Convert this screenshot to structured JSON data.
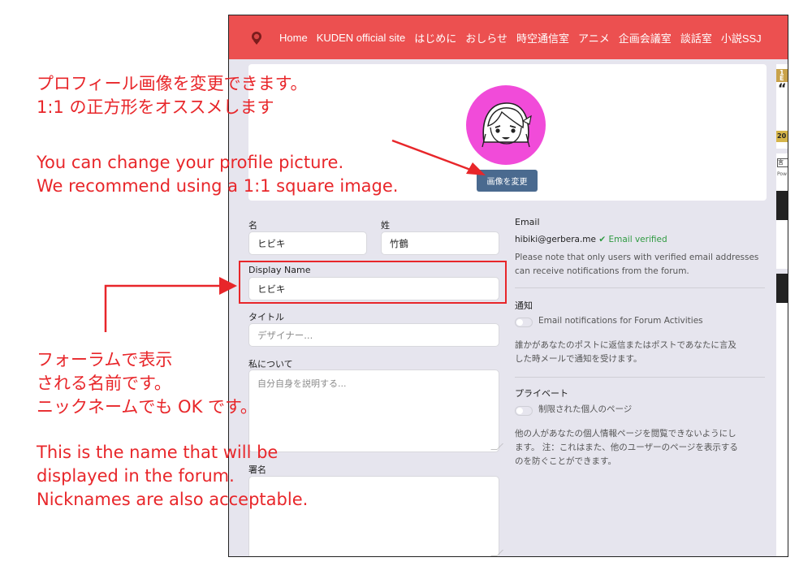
{
  "nav": {
    "items": [
      "Home",
      "KUDEN official site",
      "はじめに",
      "おしらせ",
      "時空通信室",
      "アニメ",
      "企画会議室",
      "談話室",
      "小説SSJ"
    ]
  },
  "profile": {
    "change_picture_label": "画像を変更"
  },
  "form": {
    "first_name_label": "名",
    "first_name_value": "ヒビキ",
    "last_name_label": "姓",
    "last_name_value": "竹鶴",
    "display_name_label": "Display Name",
    "display_name_value": "ヒビキ",
    "title_label": "タイトル",
    "title_placeholder": "デザイナー...",
    "about_label": "私について",
    "about_placeholder": "自分自身を説明する...",
    "signature_label": "署名"
  },
  "email": {
    "label": "Email",
    "address": "hibiki@gerbera.me",
    "verified": "Email verified",
    "note_line1": "Please note that only users with verified email addresses",
    "note_line2": "can receive notifications from the forum."
  },
  "notifications": {
    "heading": "通知",
    "toggle_label": "Email notifications for Forum Activities",
    "desc_line1": "誰かがあなたのポストに返信またはポストであなたに言及",
    "desc_line2": "した時メールで通知を受けます。"
  },
  "privacy": {
    "heading": "プライベート",
    "toggle_label": "制限された個人のページ",
    "desc_line1": "他の人があなたの個人情報ページを閲覧できないようにし",
    "desc_line2": "ます。 注：これはまた、他のユーザーのページを表示する",
    "desc_line3": "のを防ぐことができます。"
  },
  "sidebar_fragments": {
    "f1": "1",
    "f2": "E",
    "f3": "“",
    "f4": "20",
    "f5": "言",
    "f6": "Pow"
  },
  "annotations": {
    "picture_jp_1": "プロフィール画像を変更できます。",
    "picture_jp_2": "1:1 の正方形をオススメします",
    "picture_en_1": "You can change your profile picture.",
    "picture_en_2": "We recommend using a 1:1 square image.",
    "name_jp_1": "フォーラムで表示",
    "name_jp_2": "される名前です。",
    "name_jp_3": "ニックネームでも OK です。",
    "name_en_1": "This is the name that will be",
    "name_en_2": "displayed in the forum.",
    "name_en_3": "Nicknames are also acceptable."
  },
  "colors": {
    "nav": "#ec5050",
    "button": "#4a6a8f",
    "avatar_bg": "#f14bd9",
    "annotation": "#e8262a",
    "verified": "#2f9a41"
  }
}
